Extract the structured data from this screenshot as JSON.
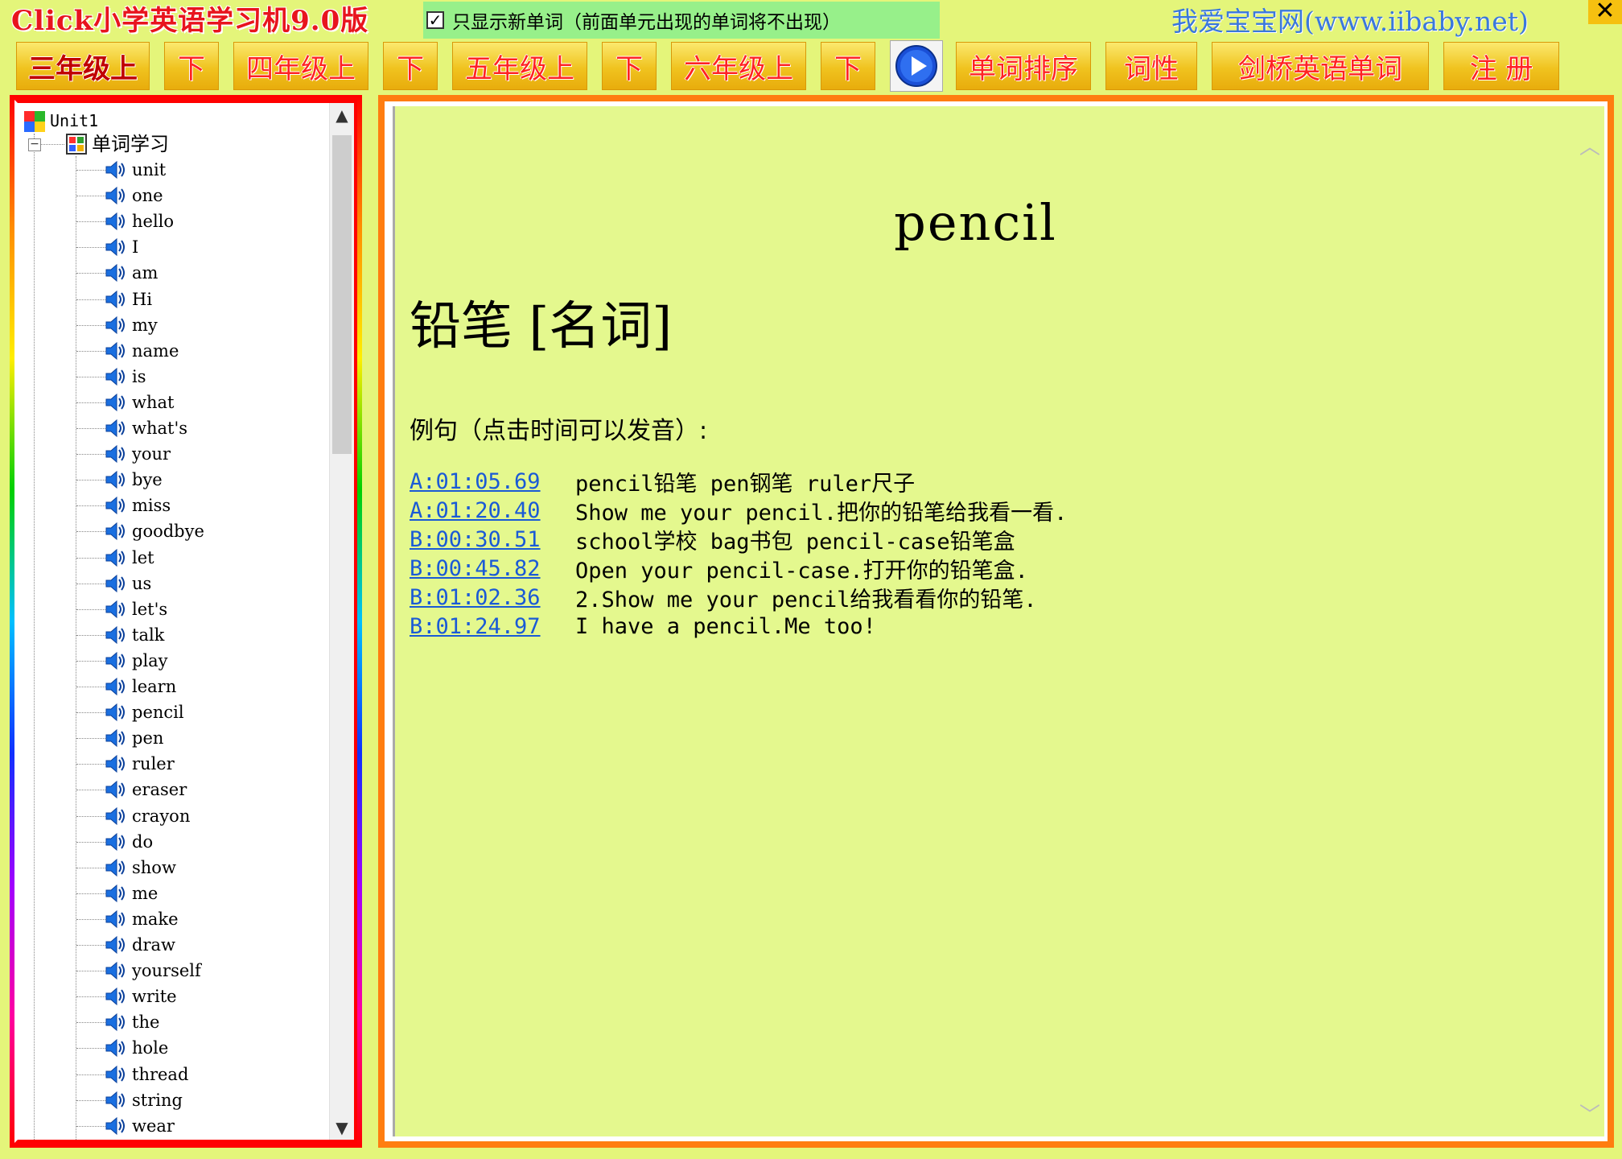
{
  "app": {
    "title": "Click小学英语学习机9.0版",
    "filter_label": "只显示新单词（前面单元出现的单词将不出现）",
    "filter_checked": "✓",
    "site": "我爱宝宝网(www.iibaby.net)",
    "close_glyph": "✕"
  },
  "toolbar": {
    "buttons": [
      {
        "label": "三年级上",
        "active": true
      },
      {
        "label": "下"
      },
      {
        "label": "四年级上"
      },
      {
        "label": "下"
      },
      {
        "label": "五年级上"
      },
      {
        "label": "下"
      },
      {
        "label": "六年级上"
      },
      {
        "label": "下"
      },
      {
        "label": "单词排序"
      },
      {
        "label": "词性"
      },
      {
        "label": "剑桥英语单词"
      },
      {
        "label": "注 册"
      }
    ],
    "play_icon": "play-icon"
  },
  "tree": {
    "root": "Unit1",
    "group": "单词学习",
    "collapse_glyph": "−",
    "words": [
      "unit",
      "one",
      "hello",
      "I",
      "am",
      "Hi",
      "my",
      "name",
      "is",
      "what",
      "what's",
      "your",
      "bye",
      "miss",
      "goodbye",
      "let",
      "us",
      "let's",
      "talk",
      "play",
      "learn",
      "pencil",
      "pen",
      "ruler",
      "eraser",
      "crayon",
      "do",
      "show",
      "me",
      "make",
      "draw",
      "yourself",
      "write",
      "the",
      "hole",
      "thread",
      "string",
      "wear"
    ],
    "scroll_up": "▲",
    "scroll_down": "▼"
  },
  "content": {
    "word": "pencil",
    "meaning": "铅笔 [名词]",
    "examples_heading": "例句（点击时间可以发音）:",
    "examples": [
      {
        "time": "A:01:05.69",
        "text": "pencil铅笔 pen钢笔 ruler尺子"
      },
      {
        "time": "A:01:20.40",
        "text": "Show me your pencil.把你的铅笔给我看一看."
      },
      {
        "time": "B:00:30.51",
        "text": "school学校 bag书包 pencil-case铅笔盒"
      },
      {
        "time": "B:00:45.82",
        "text": "Open your pencil-case.打开你的铅笔盒."
      },
      {
        "time": "B:01:02.36",
        "text": "2.Show me your pencil给我看看你的铅笔."
      },
      {
        "time": "B:01:24.97",
        "text": "I have a pencil.Me too!"
      }
    ],
    "scroll_up": "︿",
    "scroll_down": "﹀"
  }
}
